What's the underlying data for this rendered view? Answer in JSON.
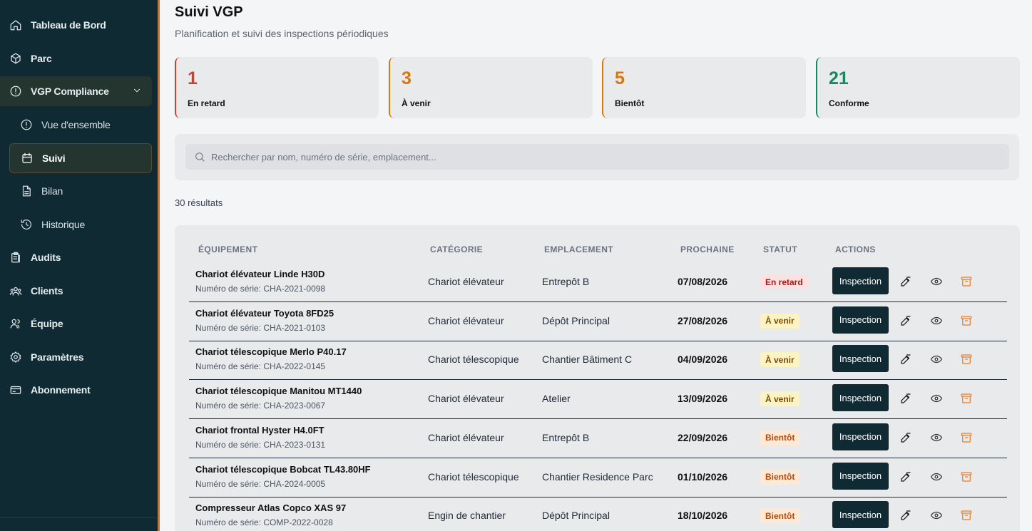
{
  "colors": {
    "accent": "#e36b1a",
    "sidebar_bg": "#0f2a33",
    "late": "#d83b2a",
    "upcoming": "#d9770b",
    "soon": "#d9770b",
    "compliant": "#128c5e"
  },
  "sidebar": {
    "items": [
      {
        "label": "Tableau de Bord",
        "icon": "home-icon"
      },
      {
        "label": "Parc",
        "icon": "box-icon"
      },
      {
        "label": "VGP Compliance",
        "icon": "alert-circle-icon"
      },
      {
        "label": "Vue d'ensemble",
        "icon": "alert-circle-icon"
      },
      {
        "label": "Suivi",
        "icon": "calendar-icon"
      },
      {
        "label": "Bilan",
        "icon": "file-icon"
      },
      {
        "label": "Historique",
        "icon": "history-icon"
      },
      {
        "label": "Audits",
        "icon": "clipboard-icon"
      },
      {
        "label": "Clients",
        "icon": "users-icon"
      },
      {
        "label": "Équipe",
        "icon": "team-icon"
      },
      {
        "label": "Paramètres",
        "icon": "gear-icon"
      },
      {
        "label": "Abonnement",
        "icon": "credit-card-icon"
      }
    ]
  },
  "header": {
    "title": "Suivi VGP",
    "subtitle": "Planification et suivi des inspections périodiques"
  },
  "kpis": [
    {
      "value": "1",
      "label": "En retard"
    },
    {
      "value": "3",
      "label": "À venir"
    },
    {
      "value": "5",
      "label": "Bientôt"
    },
    {
      "value": "21",
      "label": "Conforme"
    }
  ],
  "search": {
    "placeholder": "Rechercher par nom, numéro de série, emplacement..."
  },
  "results_text": "30 résultats",
  "table": {
    "headers": [
      "ÉQUIPEMENT",
      "CATÉGORIE",
      "EMPLACEMENT",
      "PROCHAINE",
      "STATUT",
      "ACTIONS"
    ],
    "action_label": "Inspection",
    "rows": [
      {
        "name": "Chariot élévateur Linde H30D",
        "serial": "Numéro de série: CHA-2021-0098",
        "category": "Chariot élévateur",
        "location": "Entrepôt B",
        "date": "07/08/2026",
        "status": "En retard"
      },
      {
        "name": "Chariot élévateur Toyota 8FD25",
        "serial": "Numéro de série: CHA-2021-0103",
        "category": "Chariot élévateur",
        "location": "Dépôt Principal",
        "date": "27/08/2026",
        "status": "À venir"
      },
      {
        "name": "Chariot télescopique Merlo P40.17",
        "serial": "Numéro de série: CHA-2022-0145",
        "category": "Chariot télescopique",
        "location": "Chantier Bâtiment C",
        "date": "04/09/2026",
        "status": "À venir"
      },
      {
        "name": "Chariot télescopique Manitou MT1440",
        "serial": "Numéro de série: CHA-2023-0067",
        "category": "Chariot élévateur",
        "location": "Atelier",
        "date": "13/09/2026",
        "status": "À venir"
      },
      {
        "name": "Chariot frontal Hyster H4.0FT",
        "serial": "Numéro de série: CHA-2023-0131",
        "category": "Chariot élévateur",
        "location": "Entrepôt B",
        "date": "22/09/2026",
        "status": "Bientôt"
      },
      {
        "name": "Chariot télescopique Bobcat TL43.80HF",
        "serial": "Numéro de série: CHA-2024-0005",
        "category": "Chariot télescopique",
        "location": "Chantier Residence Parc",
        "date": "01/10/2026",
        "status": "Bientôt"
      },
      {
        "name": "Compresseur Atlas Copco XAS 97",
        "serial": "Numéro de série: COMP-2022-0028",
        "category": "Engin de chantier",
        "location": "Dépôt Principal",
        "date": "18/10/2026",
        "status": "Bientôt"
      }
    ]
  }
}
